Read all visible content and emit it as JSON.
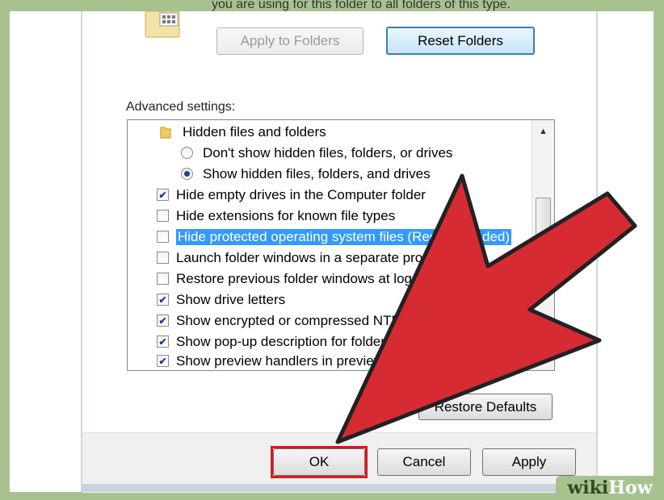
{
  "folder_views": {
    "description": "you are using for this folder to all folders of this type.",
    "apply_to_folders_label": "Apply to Folders",
    "reset_folders_label": "Reset Folders"
  },
  "advanced": {
    "label": "Advanced settings:",
    "items": [
      {
        "kind": "folder",
        "text": "Hidden files and folders"
      },
      {
        "kind": "radio",
        "checked": false,
        "text": "Don't show hidden files, folders, or drives"
      },
      {
        "kind": "radio",
        "checked": true,
        "text": "Show hidden files, folders, and drives"
      },
      {
        "kind": "checkbox",
        "checked": true,
        "text": "Hide empty drives in the Computer folder"
      },
      {
        "kind": "checkbox",
        "checked": false,
        "text": "Hide extensions for known file types"
      },
      {
        "kind": "checkbox",
        "checked": false,
        "selected": true,
        "text": "Hide protected operating system files (Recommended)"
      },
      {
        "kind": "checkbox",
        "checked": false,
        "text": "Launch folder windows in a separate process"
      },
      {
        "kind": "checkbox",
        "checked": false,
        "text": "Restore previous folder windows at logon"
      },
      {
        "kind": "checkbox",
        "checked": true,
        "text": "Show drive letters"
      },
      {
        "kind": "checkbox",
        "checked": true,
        "text": "Show encrypted or compressed NTFS files in color"
      },
      {
        "kind": "checkbox",
        "checked": true,
        "text": "Show pop-up description for folder and desktop items"
      },
      {
        "kind": "checkbox",
        "checked": true,
        "text": "Show preview handlers in preview pane"
      }
    ],
    "restore_defaults_label": "Restore Defaults"
  },
  "footer": {
    "ok_label": "OK",
    "cancel_label": "Cancel",
    "apply_label": "Apply"
  },
  "watermark": {
    "wiki": "wiki",
    "how": "How"
  },
  "colors": {
    "selection": "#3399ff",
    "highlight_box": "#e0141f",
    "arrow_fill": "#d62b33",
    "background": "#a7c28f"
  },
  "icons": [
    "folder-icon",
    "scroll-up-icon",
    "red-arrow-icon"
  ]
}
